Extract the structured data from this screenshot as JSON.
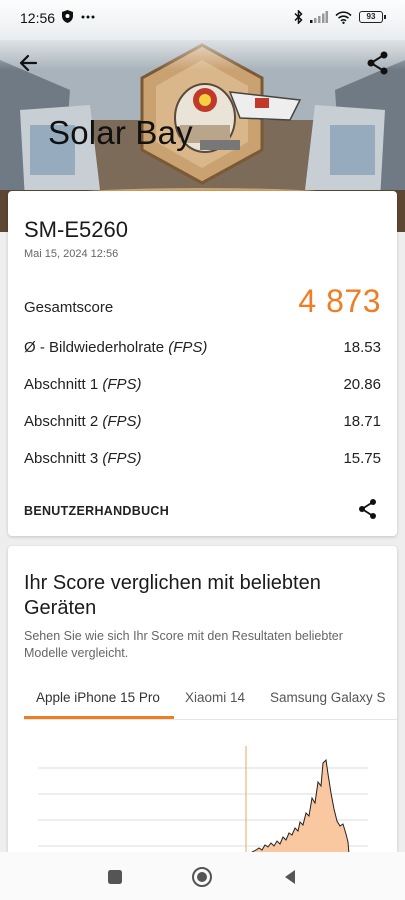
{
  "status_bar": {
    "time": "12:56",
    "battery": "93",
    "left_icons": [
      "shield-icon",
      "more-dots-icon"
    ],
    "right_icons": [
      "bluetooth-icon",
      "signal-icon",
      "wifi-icon",
      "battery-icon"
    ]
  },
  "header": {
    "title": "Solar Bay",
    "back_icon": "arrow-left-icon",
    "share_icon": "share-icon"
  },
  "result": {
    "device_name": "SM-E5260",
    "date": "Mai 15, 2024 12:56",
    "total_label": "Gesamtscore",
    "total_score": "4 873",
    "metrics": [
      {
        "label": "Ø - Bildwiederholrate",
        "unit": "(FPS)",
        "value": "18.53"
      },
      {
        "label": "Abschnitt 1",
        "unit": "(FPS)",
        "value": "20.86"
      },
      {
        "label": "Abschnitt 2",
        "unit": "(FPS)",
        "value": "18.71"
      },
      {
        "label": "Abschnitt 3",
        "unit": "(FPS)",
        "value": "15.75"
      }
    ],
    "manual_label": "BENUTZERHANDBUCH"
  },
  "comparison": {
    "title": "Ihr Score verglichen mit beliebten Geräten",
    "subtitle": "Sehen Sie wie sich Ihr Score mit den Resultaten beliebter Modelle vergleicht.",
    "tabs": [
      "Apple iPhone 15 Pro",
      "Xiaomi 14",
      "Samsung Galaxy S"
    ],
    "active_tab": 0
  },
  "colors": {
    "accent": "#f07d22",
    "histogram_fill": "#f9c7a0",
    "histogram_stroke": "#222222"
  },
  "nav": [
    "recents-square-icon",
    "home-circle-icon",
    "back-triangle-icon"
  ]
}
